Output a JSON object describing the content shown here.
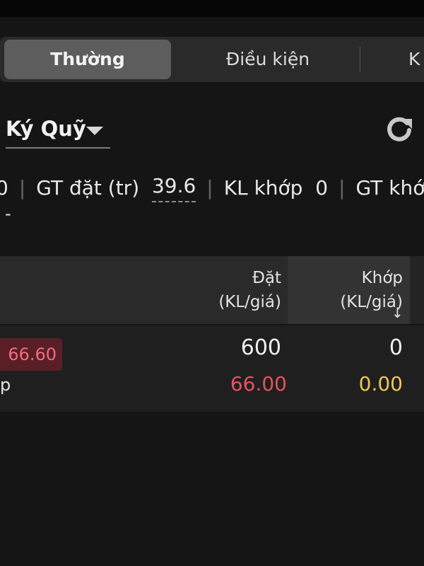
{
  "tabs": [
    {
      "label": "Thường",
      "active": true
    },
    {
      "label": "Điều kiện",
      "active": false
    },
    {
      "label": "K",
      "active": false
    }
  ],
  "account": {
    "label": "Ký Quỹ",
    "icon": "chevron-down-icon"
  },
  "refresh_icon": "refresh-icon",
  "stats": {
    "prev_value": "0",
    "gt_dat_label": "GT đặt (tr)",
    "gt_dat_value": "39.6",
    "kl_khop_label": "KL khớp",
    "kl_khop_value": "0",
    "gt_khop_label": "GT khớ",
    "second_line": "-"
  },
  "table": {
    "headers": {
      "dat": [
        "Đặt",
        "(KL/giá)"
      ],
      "khop": [
        "Khớp",
        "(KL/giá)"
      ],
      "sort_icon": "sort-down-icon"
    },
    "rows": [
      {
        "price_badge": "66.60",
        "sub_text": "p",
        "order_qty": "600",
        "order_price": "66.00",
        "match_qty": "0",
        "match_price": "0.00"
      }
    ]
  },
  "colors": {
    "background": "#151515",
    "tab_active": "#5d5d5d",
    "sell_red": "#e3535f",
    "match_yellow": "#efc45a"
  }
}
